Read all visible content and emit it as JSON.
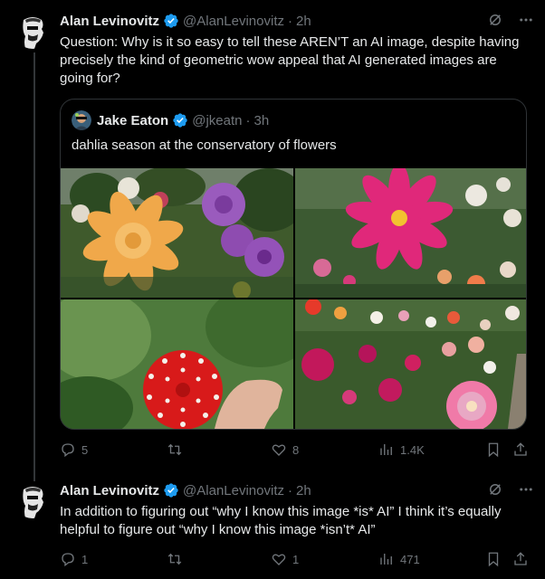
{
  "tweets": [
    {
      "author": {
        "name": "Alan Levinovitz",
        "handle": "@AlanLevinovitz",
        "time": "2h"
      },
      "text": "Question: Why is it so easy to tell these AREN’T an AI image, despite having precisely the kind of geometric wow appeal that AI generated images are going for?",
      "quote": {
        "author": {
          "name": "Jake Eaton",
          "handle": "@jkeatn",
          "time": "3h"
        },
        "text": "dahlia season at the conservatory of flowers",
        "photos": [
          "orange-dahlia-photo",
          "magenta-dahlia-photo",
          "red-white-dahlia-photo",
          "dahlia-garden-photo"
        ]
      },
      "stats": {
        "replies": "5",
        "retweets": "",
        "likes": "8",
        "views": "1.4K"
      }
    },
    {
      "author": {
        "name": "Alan Levinovitz",
        "handle": "@AlanLevinovitz",
        "time": "2h"
      },
      "text": "In addition to figuring out “why I know this image *is* AI” I think it’s equally helpful to figure out “why I know this image *isn’t* AI”",
      "stats": {
        "replies": "1",
        "retweets": "",
        "likes": "1",
        "views": "471"
      }
    }
  ],
  "colors": {
    "background": "#000000",
    "text": "#e7e9ea",
    "muted": "#71767b",
    "border": "#2f3336",
    "verified": "#1d9bf0"
  },
  "icons": [
    "verified-badge-icon",
    "grok-icon",
    "more-icon",
    "reply-icon",
    "retweet-icon",
    "like-icon",
    "views-icon",
    "bookmark-icon",
    "share-icon"
  ]
}
